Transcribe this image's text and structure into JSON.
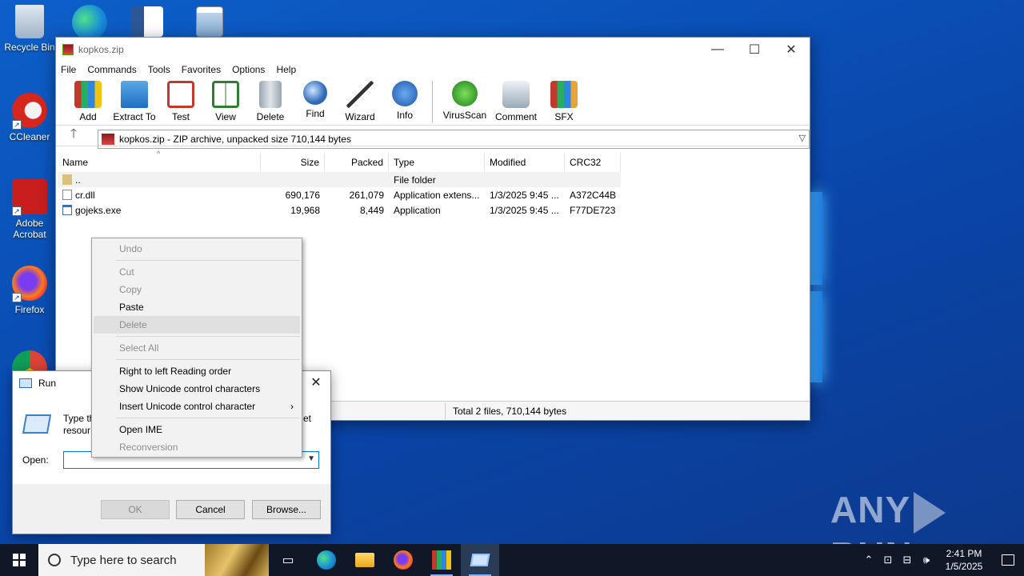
{
  "desktop": {
    "icons": [
      {
        "label": "Recycle Bin",
        "icon": "recycle-bin-icon"
      },
      {
        "label": "CCleaner",
        "icon": "ccleaner-icon"
      },
      {
        "label": "Adobe Acrobat",
        "icon": "adobe-acrobat-icon"
      },
      {
        "label": "Firefox",
        "icon": "firefox-icon"
      }
    ],
    "watermark": "ANY RUN"
  },
  "winrar": {
    "title": "kopkos.zip",
    "menu": [
      "File",
      "Commands",
      "Tools",
      "Favorites",
      "Options",
      "Help"
    ],
    "toolbar": [
      "Add",
      "Extract To",
      "Test",
      "View",
      "Delete",
      "Find",
      "Wizard",
      "Info",
      "VirusScan",
      "Comment",
      "SFX"
    ],
    "address": "kopkos.zip - ZIP archive, unpacked size 710,144 bytes",
    "columns": {
      "name": "Name",
      "size": "Size",
      "packed": "Packed",
      "type": "Type",
      "modified": "Modified",
      "crc": "CRC32"
    },
    "rows": [
      {
        "name": "..",
        "size": "",
        "packed": "",
        "type": "File folder",
        "modified": "",
        "crc": ""
      },
      {
        "name": "cr.dll",
        "size": "690,176",
        "packed": "261,079",
        "type": "Application extens...",
        "modified": "1/3/2025 9:45 ...",
        "crc": "A372C44B"
      },
      {
        "name": "gojeks.exe",
        "size": "19,968",
        "packed": "8,449",
        "type": "Application",
        "modified": "1/3/2025 9:45 ...",
        "crc": "F77DE723"
      }
    ],
    "status": "Total 2 files, 710,144 bytes"
  },
  "run_dialog": {
    "title": "Run",
    "desc_left": "Type th resour",
    "desc_right": "et",
    "open_label": "Open:",
    "open_value": "",
    "ok": "OK",
    "cancel": "Cancel",
    "browse": "Browse..."
  },
  "context_menu": {
    "undo": "Undo",
    "cut": "Cut",
    "copy": "Copy",
    "paste": "Paste",
    "delete": "Delete",
    "select_all": "Select All",
    "rtl": "Right to left Reading order",
    "show_unicode": "Show Unicode control characters",
    "insert_unicode": "Insert Unicode control character",
    "open_ime": "Open IME",
    "reconversion": "Reconversion"
  },
  "taskbar": {
    "search_placeholder": "Type here to search",
    "time": "2:41 PM",
    "date": "1/5/2025"
  }
}
